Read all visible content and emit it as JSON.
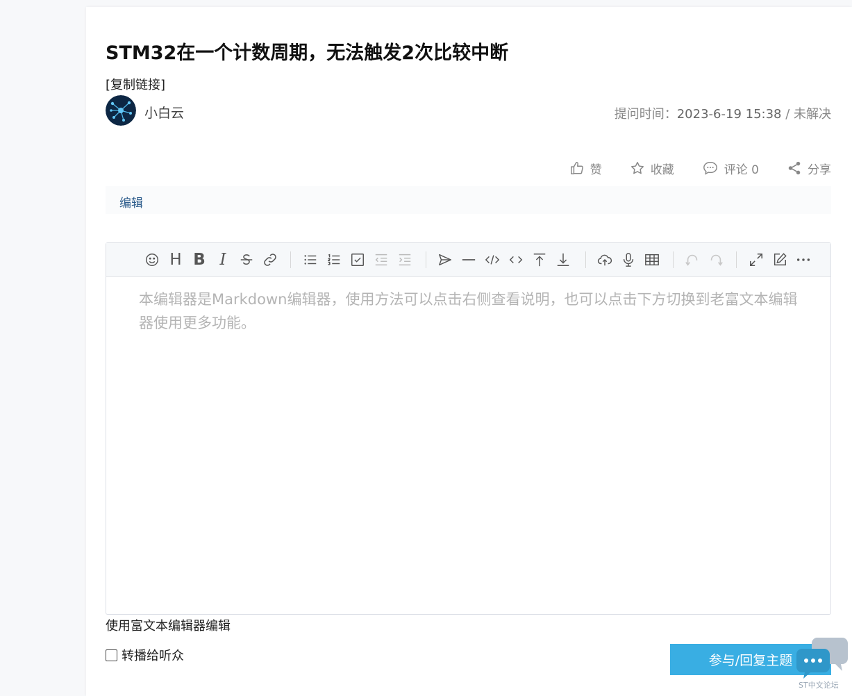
{
  "post": {
    "title": "STM32在一个计数周期，无法触发2次比较中断",
    "copy_link": "[复制链接]",
    "author": "小白云",
    "meta_label": "提问时间：",
    "date": "2023-6-19 15:38",
    "status_sep": " / ",
    "status": "未解决"
  },
  "actions": {
    "like": "赞",
    "favorite": "收藏",
    "comment": "评论 0",
    "share": "分享"
  },
  "edit_link": "编辑",
  "editor": {
    "toolbar_icons": [
      "emoji-icon",
      "heading-icon",
      "bold-icon",
      "italic-icon",
      "strike-icon",
      "link-icon",
      "bullet-list-icon",
      "ordered-list-icon",
      "checklist-icon",
      "outdent-icon",
      "indent-icon",
      "quote-icon",
      "hr-icon",
      "code-block-icon",
      "inline-code-icon",
      "insert-before-icon",
      "insert-after-icon",
      "upload-icon",
      "record-icon",
      "table-icon",
      "undo-icon",
      "redo-icon",
      "fullscreen-icon",
      "edit-mode-icon",
      "more-icon"
    ],
    "heading_glyph": "H",
    "bold_glyph": "B",
    "italic_glyph": "I",
    "placeholder": "本编辑器是Markdown编辑器，使用方法可以点击右侧查看说明，也可以点击下方切换到老富文本编辑器使用更多功能。"
  },
  "switch_editor": "使用富文本编辑器编辑",
  "broadcast_label": "转播给听众",
  "reply_button": "参与/回复主题",
  "forum_label": "ST中文论坛",
  "colors": {
    "accent": "#39aee3",
    "link": "#2a5a8a",
    "muted": "#888888"
  }
}
